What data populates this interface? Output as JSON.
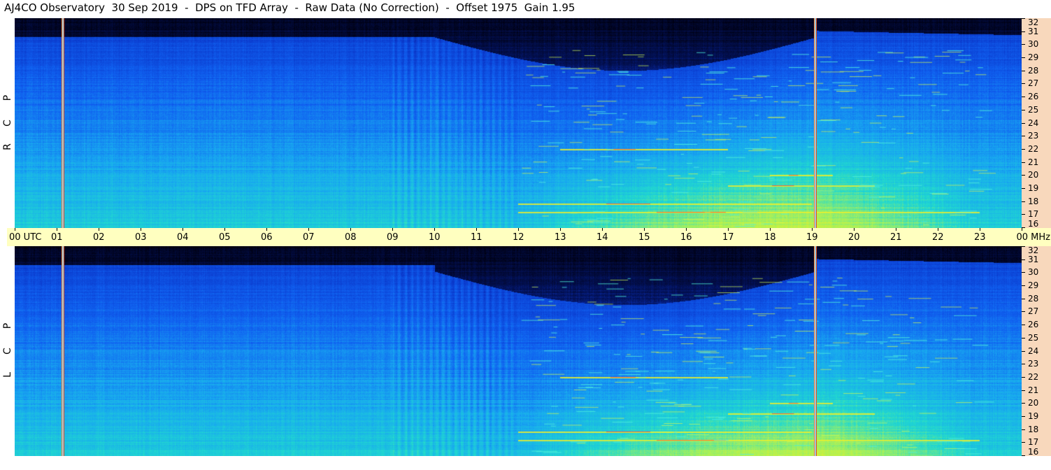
{
  "title": "AJ4CO Observatory  30 Sep 2019  -  DPS on TFD Array  -  Raw Data (No Correction)  -  Offset 1975  Gain 1.95",
  "panels": [
    {
      "name": "rcp",
      "letters": [
        "R",
        "C",
        "P"
      ]
    },
    {
      "name": "lcp",
      "letters": [
        "L",
        "C",
        "P"
      ]
    }
  ],
  "colors": {
    "background": "#ffffff",
    "scale_bg": "#f8d8bc",
    "time_strip_bg": "#ffffc0",
    "marker": "#ff8a3d"
  },
  "chart_data": {
    "type": "heatmap",
    "title": "AJ4CO Observatory  30 Sep 2019  -  DPS on TFD Array  -  Raw Data (No Correction)  -  Offset 1975  Gain 1.95",
    "x_ticks": [
      "00 UTC",
      "01",
      "02",
      "03",
      "04",
      "05",
      "06",
      "07",
      "08",
      "09",
      "10",
      "11",
      "12",
      "13",
      "14",
      "15",
      "16",
      "17",
      "18",
      "19",
      "20",
      "21",
      "22",
      "23",
      "00 MHz"
    ],
    "x_range_hours": [
      0,
      24
    ],
    "y_ticks": [
      "32",
      "31",
      "30",
      "29",
      "28",
      "27",
      "26",
      "25",
      "24",
      "23",
      "22",
      "21",
      "20",
      "19",
      "18",
      "17",
      "16"
    ],
    "y_range_mhz": [
      16,
      32
    ],
    "series": [
      {
        "name": "RCP",
        "labels": [
          "R",
          "C",
          "P"
        ]
      },
      {
        "name": "LCP",
        "labels": [
          "L",
          "C",
          "P"
        ]
      }
    ],
    "vertical_markers_utc": [
      1.15,
      19.08
    ],
    "notable_features": [
      {
        "utc_start": 12.0,
        "utc_end": 23.0,
        "mhz": 17.2
      },
      {
        "utc_start": 12.0,
        "utc_end": 19.0,
        "mhz": 17.8
      },
      {
        "utc_start": 18.0,
        "utc_end": 19.5,
        "mhz": 20.0
      },
      {
        "utc_start": 17.0,
        "utc_end": 20.5,
        "mhz": 19.2
      },
      {
        "utc_start": 13.0,
        "utc_end": 17.0,
        "mhz": 22.0
      }
    ],
    "colormap": [
      "#000010",
      "#03125a",
      "#0a35c8",
      "#1060f0",
      "#18a8f0",
      "#20d8d0",
      "#a0f060",
      "#f0f020",
      "#ff3030"
    ]
  }
}
